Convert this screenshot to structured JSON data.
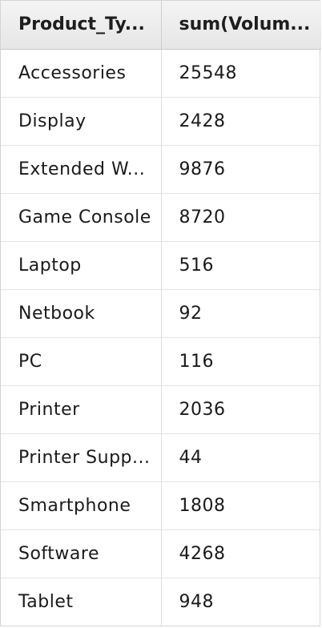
{
  "table": {
    "columns": [
      "Product_Ty...",
      "sum(Volum..."
    ],
    "rows": [
      [
        "Accessories",
        "25548"
      ],
      [
        "Display",
        "2428"
      ],
      [
        "Extended W...",
        "9876"
      ],
      [
        "Game Console",
        "8720"
      ],
      [
        "Laptop",
        "516"
      ],
      [
        "Netbook",
        "92"
      ],
      [
        "PC",
        "116"
      ],
      [
        "Printer",
        "2036"
      ],
      [
        "Printer Supp...",
        "44"
      ],
      [
        "Smartphone",
        "1808"
      ],
      [
        "Software",
        "4268"
      ],
      [
        "Tablet",
        "948"
      ]
    ]
  }
}
